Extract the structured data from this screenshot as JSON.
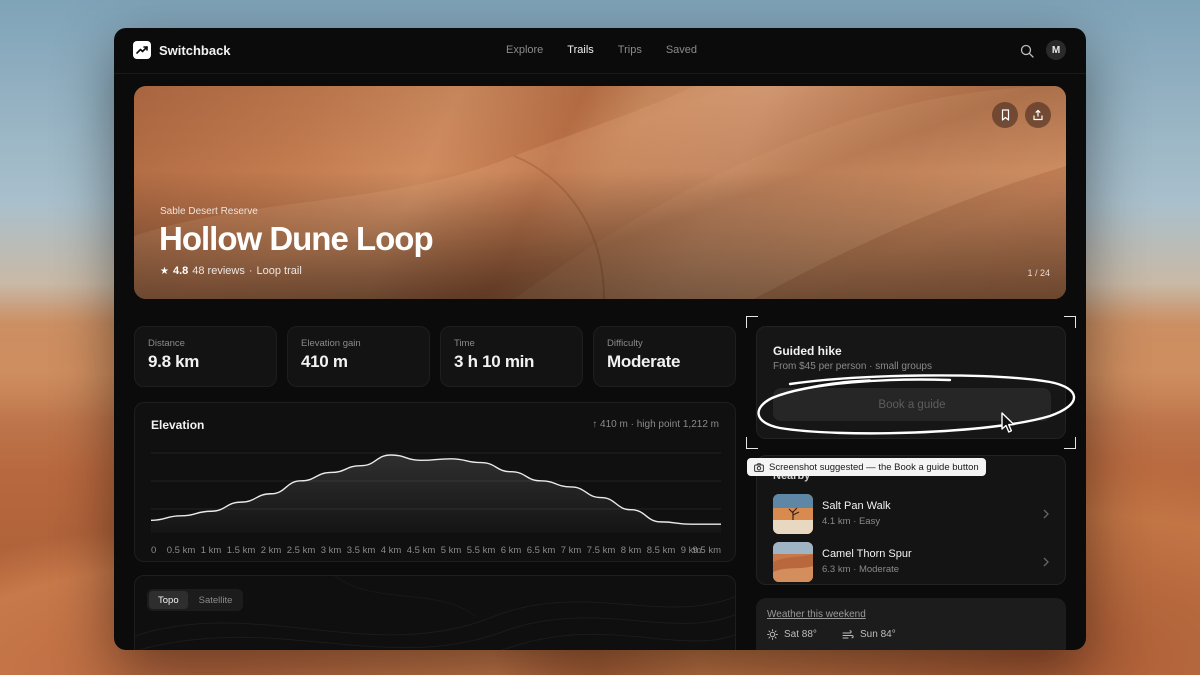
{
  "app": {
    "name": "Switchback"
  },
  "nav": {
    "links": [
      {
        "label": "Explore",
        "active": false
      },
      {
        "label": "Trails",
        "active": true
      },
      {
        "label": "Trips",
        "active": false
      },
      {
        "label": "Saved",
        "active": false
      }
    ],
    "avatar_initial": "M"
  },
  "hero": {
    "reserve": "Sable Desert Reserve",
    "title": "Hollow Dune Loop",
    "rating": "4.8",
    "reviews": "48 reviews",
    "trail_type": "Loop trail",
    "photo_counter": "1 / 24",
    "actions": [
      "bookmark-icon",
      "share-icon"
    ]
  },
  "stats": [
    {
      "label": "Distance",
      "value": "9.8 km"
    },
    {
      "label": "Elevation gain",
      "value": "410 m"
    },
    {
      "label": "Time",
      "value": "3 h 10 min"
    },
    {
      "label": "Difficulty",
      "value": "Moderate"
    }
  ],
  "elevation": {
    "title": "Elevation",
    "gain": "410 m",
    "high_point": "high point 1,212 m"
  },
  "chart_data": {
    "type": "area",
    "title": "Elevation",
    "x": [
      "0",
      "0.5 km",
      "1 km",
      "1.5 km",
      "2 km",
      "2.5 km",
      "3 km",
      "3.5 km",
      "4 km",
      "4.5 km",
      "5 km",
      "5.5 km",
      "6 km",
      "6.5 km",
      "7 km",
      "7.5 km",
      "8 km",
      "8.5 km",
      "9 km",
      "9.5 km"
    ],
    "y_relative": [
      0.14,
      0.2,
      0.26,
      0.38,
      0.49,
      0.66,
      0.77,
      0.86,
      1.0,
      0.93,
      0.95,
      0.9,
      0.78,
      0.66,
      0.58,
      0.44,
      0.28,
      0.12,
      0.09,
      0.09
    ],
    "grid": true,
    "color": "#ffffff"
  },
  "map": {
    "modes": [
      {
        "label": "Topo",
        "active": true
      },
      {
        "label": "Satellite",
        "active": false
      }
    ]
  },
  "guided": {
    "title": "Guided hike",
    "subtitle": "From $45 per person · small groups",
    "button": "Book a guide"
  },
  "toast": {
    "text": "Screenshot suggested — the Book a guide button"
  },
  "nearby": {
    "title": "Nearby",
    "items": [
      {
        "name": "Salt Pan Walk",
        "meta": "4.1 km · Easy"
      },
      {
        "name": "Camel Thorn Spur",
        "meta": "6.3 km · Moderate"
      }
    ]
  },
  "weather": {
    "link": "Weather this weekend",
    "days": [
      {
        "label": "Sat 88°",
        "icon": "sun-icon"
      },
      {
        "label": "Sun 84°",
        "icon": "wind-icon"
      }
    ]
  }
}
